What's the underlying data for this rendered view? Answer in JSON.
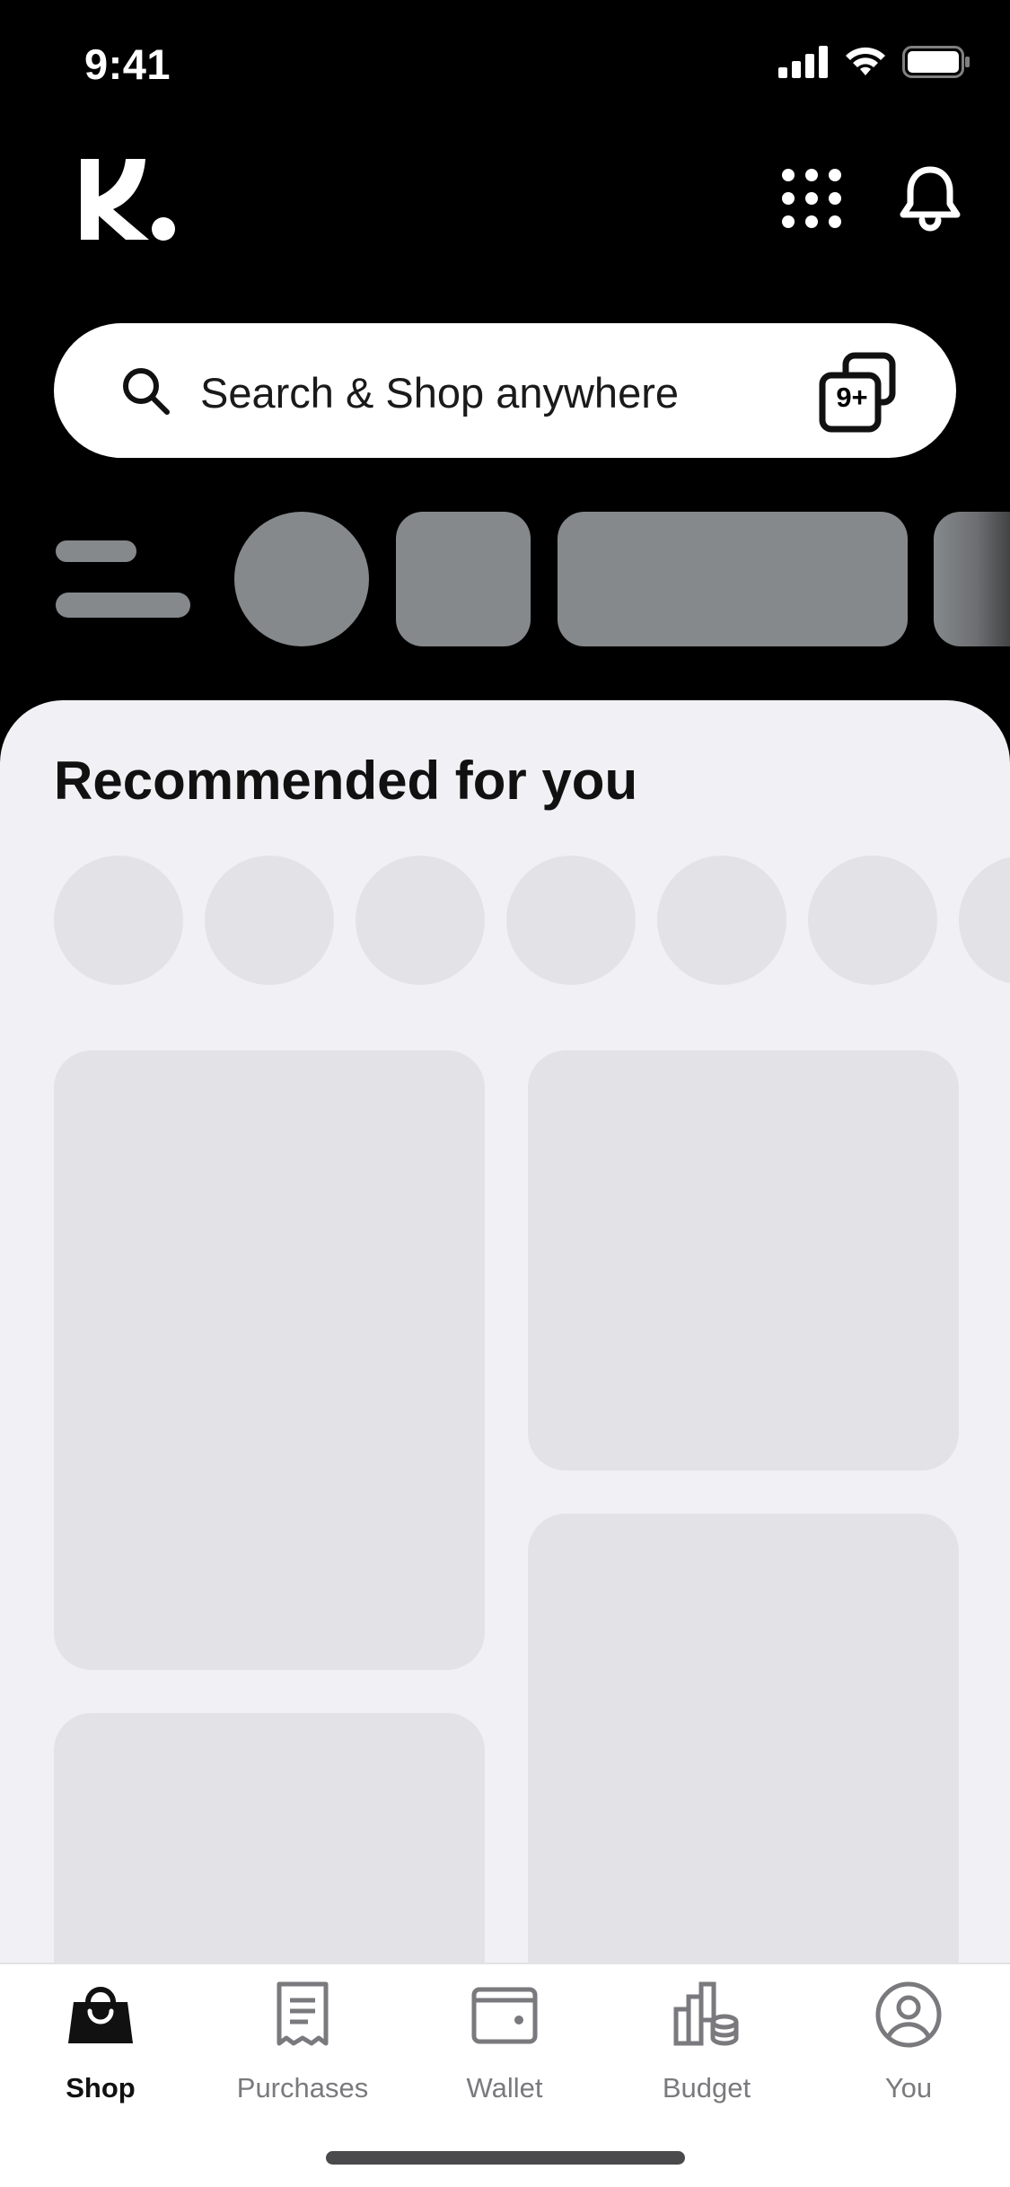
{
  "status_bar": {
    "time": "9:41"
  },
  "header": {
    "logo_icon": "klarna-k-logo",
    "apps_icon": "grid-dots-icon",
    "notifications_icon": "bell-icon"
  },
  "search": {
    "placeholder": "Search & Shop anywhere",
    "tabs_count": "9+"
  },
  "recommended": {
    "title": "Recommended for you"
  },
  "bottom_nav": {
    "items": [
      {
        "label": "Shop",
        "icon": "shopping-bag-icon",
        "active": true
      },
      {
        "label": "Purchases",
        "icon": "receipt-icon",
        "active": false
      },
      {
        "label": "Wallet",
        "icon": "wallet-icon",
        "active": false
      },
      {
        "label": "Budget",
        "icon": "budget-chart-icon",
        "active": false
      },
      {
        "label": "You",
        "icon": "profile-icon",
        "active": false
      }
    ]
  },
  "colors": {
    "header_bg": "#000000",
    "sheet_bg": "#f1f1f5",
    "skeleton_dark": "#85898c",
    "skeleton_light": "#e3e3e7",
    "nav_active": "#111111",
    "nav_inactive": "#7a7a7e"
  }
}
